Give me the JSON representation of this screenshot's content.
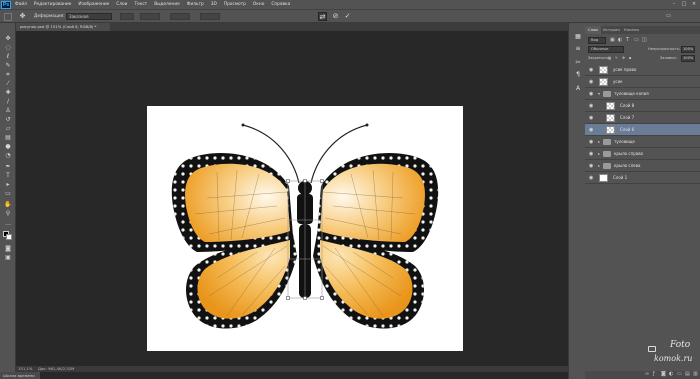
{
  "app": {
    "logo": "Ps"
  },
  "menu": [
    "Файл",
    "Редактирование",
    "Изображение",
    "Слои",
    "Текст",
    "Выделение",
    "Фильтр",
    "3D",
    "Просмотр",
    "Окно",
    "Справка"
  ],
  "options": {
    "mode_label": "Деформация:",
    "warp_value": "Заказная"
  },
  "document_tab": {
    "title": "рисунок.psd @ 151% (Слой 6, RGB/8) *"
  },
  "status": {
    "zoom": "151,1%",
    "docsize": "Док: 961,4K/2,52M"
  },
  "bottom_tab": {
    "label": "Шкала времени"
  },
  "panel": {
    "tabs": [
      "Слои",
      "История",
      "Каналы"
    ],
    "kind": "Вид",
    "blend_mode": "Обычные",
    "opacity_label": "Непрозрачность:",
    "opacity_value": "100%",
    "lock_label": "Закрепить:",
    "fill_label": "Заливка:",
    "fill_value": "100%"
  },
  "layers": [
    {
      "name": "усик право",
      "kind": "layer"
    },
    {
      "name": "усик",
      "kind": "layer"
    },
    {
      "name": "туловище копия",
      "kind": "group-open"
    },
    {
      "name": "Слой 8",
      "kind": "layer"
    },
    {
      "name": "Слой 7",
      "kind": "layer"
    },
    {
      "name": "Слой 6",
      "kind": "layer",
      "selected": true
    },
    {
      "name": "туловище",
      "kind": "group"
    },
    {
      "name": "крыло справа",
      "kind": "group"
    },
    {
      "name": "крыло слева",
      "kind": "group"
    },
    {
      "name": "Слой 1",
      "kind": "layer-white"
    }
  ],
  "watermark": {
    "line1": "Foto",
    "line2": "komok.ru"
  },
  "colors": {
    "wing_orange": "#f0a32a",
    "wing_highlight": "#fff6e0",
    "wing_border": "#111111",
    "selected_layer": "#6a7c96"
  }
}
